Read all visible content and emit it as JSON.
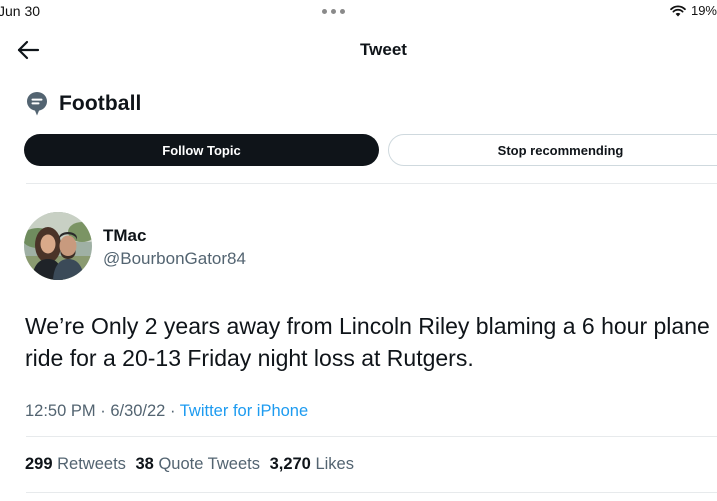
{
  "status_bar": {
    "date": "Jun 30",
    "battery": "19%"
  },
  "header": {
    "title": "Tweet",
    "back_icon": "arrow-left-icon"
  },
  "topic": {
    "icon": "topic-speech-bubble-icon",
    "title": "Football",
    "follow_label": "Follow Topic",
    "stop_label": "Stop recommending"
  },
  "tweet": {
    "user_name": "TMac",
    "user_handle": "@BourbonGator84",
    "text": "We’re Only 2 years away from Lincoln Riley blaming a 6 hour plane ride for a 20-13 Friday night loss at Rutgers.",
    "time": "12:50 PM",
    "date": "6/30/22",
    "separator": "·",
    "source": "Twitter for iPhone"
  },
  "stats": {
    "retweets_count": "299",
    "retweets_label": "Retweets",
    "quotes_count": "38",
    "quotes_label": "Quote Tweets",
    "likes_count": "3,270",
    "likes_label": "Likes"
  },
  "colors": {
    "text_primary": "#0f1419",
    "text_secondary": "#536471",
    "link_blue": "#1d9bf0",
    "button_dark": "#0f1419",
    "divider": "#e7eaec"
  }
}
